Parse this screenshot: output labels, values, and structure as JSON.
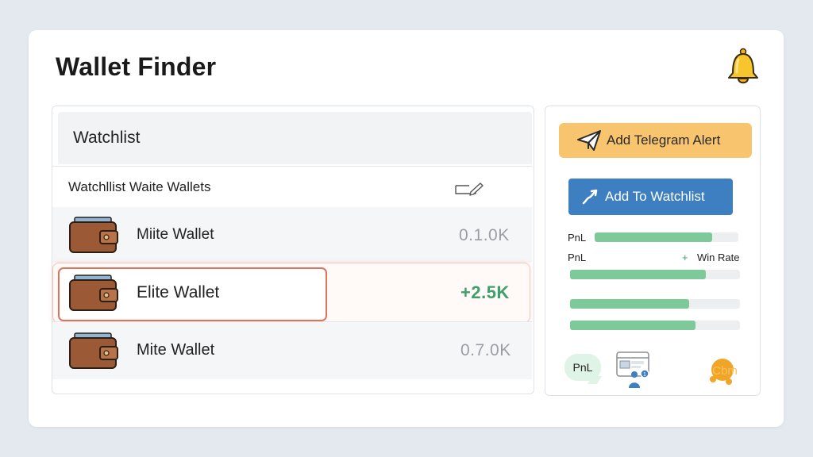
{
  "app": {
    "title": "Wallet Finder",
    "notifications_icon": "bell-icon"
  },
  "watchlist": {
    "header": "Watchlist",
    "subheader": "Watchllist Waite Wallets",
    "edit_icon": "pencil-icon",
    "rows": [
      {
        "name": "Miite Wallet",
        "value": "0.1.0K",
        "icon": "wallet-icon",
        "selected": false
      },
      {
        "name": "Elite Wallet",
        "value": "+2.5K",
        "icon": "wallet-icon",
        "selected": true
      },
      {
        "name": "Mite Wallet",
        "value": "0.7.0K",
        "icon": "wallet-icon",
        "selected": false
      }
    ]
  },
  "actions": {
    "telegram_label": "Add Telegram Alert",
    "telegram_icon": "paper-plane-icon",
    "watchlist_label": "Add To Watchlist",
    "watchlist_icon": "trend-arrow-icon"
  },
  "stats": {
    "pnl_label_1": "PnL",
    "pnl_label_2": "PnL",
    "plus": "+",
    "win_rate_label": "Win Rate",
    "bars": [
      0.82,
      0.8,
      0.7,
      0.74
    ],
    "badge_text": "PnL",
    "logo_text": "Cbm"
  },
  "colors": {
    "accent_orange": "#f9c46e",
    "accent_blue": "#3d7fc1",
    "positive_green": "#3f9f6a",
    "bar_green": "#7dc99a",
    "highlight_border": "#e0725a"
  }
}
